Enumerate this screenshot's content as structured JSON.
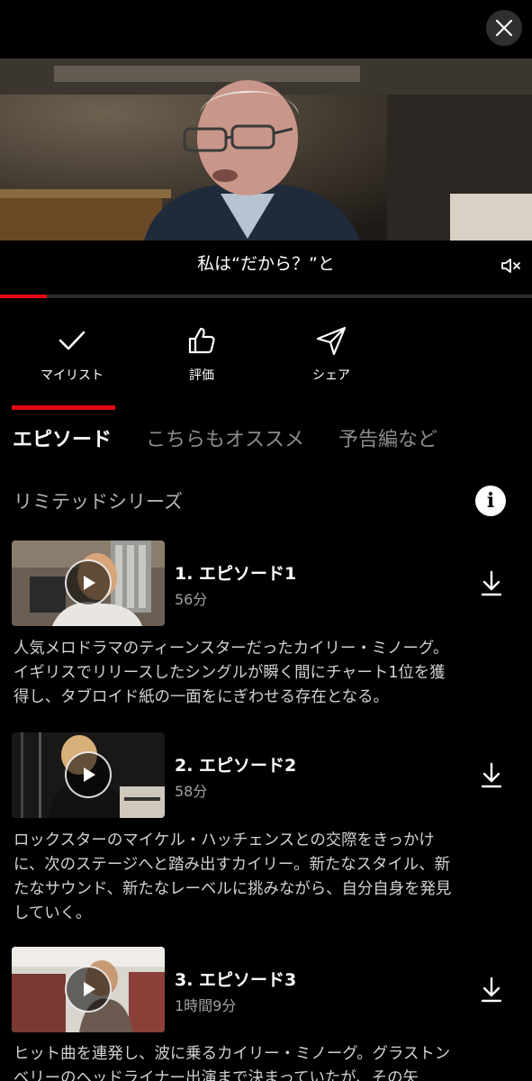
{
  "player": {
    "subtitle": "私は“だから？”と",
    "progress": 0.088
  },
  "actions": {
    "mylist": "マイリスト",
    "rate": "評価",
    "share": "シェア"
  },
  "tabs": {
    "episodes": "エピソード",
    "more_like_this": "こちらもオススメ",
    "trailers": "予告編など"
  },
  "series_label": "リミテッドシリーズ",
  "info_glyph": "i",
  "episodes": [
    {
      "title": "1. エピソード1",
      "duration": "56分",
      "desc_lines": [
        "人気メロドラマのティーンスターだったカイリー・ミノーグ。",
        "イギリスでリリースしたシングルが瞬く間にチャート1位を獲",
        "得し、タブロイド紙の一面をにぎわせる存在となる。"
      ]
    },
    {
      "title": "2. エピソード2",
      "duration": "58分",
      "desc_lines": [
        "ロックスターのマイケル・ハッチェンスとの交際をきっかけ",
        "に、次のステージへと踏み出すカイリー。新たなスタイル、新",
        "たなサウンド、新たなレーベルに挑みながら、自分自身を発見",
        "していく。"
      ]
    },
    {
      "title": "3. エピソード3",
      "duration": "1時間9分",
      "desc_lines": [
        "ヒット曲を連発し、波に乗るカイリー・ミノーグ。グラストン",
        "ベリーのヘッドライナー出演まで決まっていたが、その矢"
      ]
    }
  ],
  "colors": {
    "accent": "#e50914",
    "background": "#000000",
    "muted_text": "#8c8c8c"
  }
}
